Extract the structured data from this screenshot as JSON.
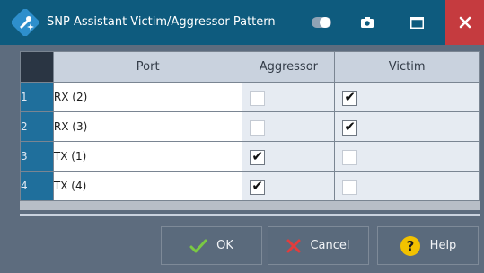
{
  "window": {
    "title": "SNP Assistant Victim/Aggressor Pattern"
  },
  "icons": {
    "app": "wrench-sparkle-icon",
    "toggle": "toggle-icon",
    "camera": "camera-icon",
    "maximize": "maximize-icon",
    "close": "close-icon",
    "ok": "check-icon",
    "cancel": "x-icon",
    "help": "question-icon"
  },
  "table": {
    "headers": {
      "port": "Port",
      "aggressor": "Aggressor",
      "victim": "Victim"
    },
    "rows": [
      {
        "num": "1",
        "port": "RX (2)",
        "aggressor": false,
        "victim": true
      },
      {
        "num": "2",
        "port": "RX (3)",
        "aggressor": false,
        "victim": true
      },
      {
        "num": "3",
        "port": "TX (1)",
        "aggressor": true,
        "victim": false
      },
      {
        "num": "4",
        "port": "TX (4)",
        "aggressor": true,
        "victim": false
      }
    ]
  },
  "buttons": {
    "ok": "OK",
    "cancel": "Cancel",
    "help": "Help"
  },
  "colors": {
    "titlebar": "#0e5b7e",
    "close": "#c53b3f",
    "ok_check": "#7ac943",
    "cancel_x": "#e23d3d",
    "help": "#f2c200"
  }
}
